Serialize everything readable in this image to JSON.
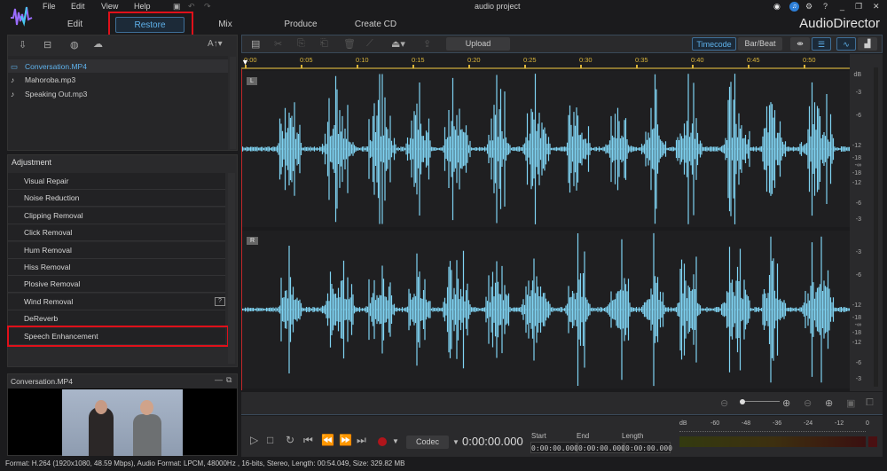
{
  "menu": {
    "items": [
      "File",
      "Edit",
      "View",
      "Help"
    ],
    "title": "audio project",
    "app_name": "AudioDirector"
  },
  "tabs": [
    {
      "label": "Edit"
    },
    {
      "label": "Restore"
    },
    {
      "label": "Mix"
    },
    {
      "label": "Produce"
    },
    {
      "label": "Create CD"
    }
  ],
  "left": {
    "font_btn": "A↑▾",
    "media": [
      {
        "name": "Conversation.MP4",
        "type": "video"
      },
      {
        "name": "Mahoroba.mp3",
        "type": "audio"
      },
      {
        "name": "Speaking Out.mp3",
        "type": "audio"
      }
    ],
    "adjustment_title": "Adjustment",
    "adjustments": [
      "Visual Repair",
      "Noise Reduction",
      "Clipping Removal",
      "Click Removal",
      "Hum Removal",
      "Hiss Removal",
      "Plosive Removal",
      "Wind Removal",
      "DeReverb",
      "Speech Enhancement"
    ],
    "preview_title": "Conversation.MP4"
  },
  "toolbar": {
    "upload": "Upload",
    "timecode": "Timecode",
    "barbeat": "Bar/Beat"
  },
  "ruler": [
    "0:00",
    "0:05",
    "0:10",
    "0:15",
    "0:20",
    "0:25",
    "0:30",
    "0:35",
    "0:40",
    "0:45",
    "0:50"
  ],
  "tracks": [
    {
      "label": "L"
    },
    {
      "label": "R"
    }
  ],
  "db_scale": [
    "-3",
    "-6",
    "-12",
    "-18",
    "-∞",
    "-18",
    "-12",
    "-6",
    "-3"
  ],
  "db_header": "dB",
  "transport": {
    "codec": "Codec",
    "time": "0:00:00.000",
    "start_label": "Start",
    "end_label": "End",
    "length_label": "Length",
    "start": "0:00:00.000",
    "end": "0:00:00.000",
    "length": "0:00:00.000"
  },
  "meter": {
    "labels": [
      "dB",
      "-60",
      "-48",
      "-36",
      "-24",
      "-12",
      "0"
    ]
  },
  "status": "Format: H.264 (1920x1080, 48.59 Mbps), Audio Format: LPCM, 48000Hz , 16-bits, Stereo, Length: 00:54.049, Size: 329.82 MB",
  "colors": {
    "accent": "#5fb2ec",
    "wave": "#7fd3f2",
    "highlight": "#e0101a",
    "ruler": "#d9b43a"
  }
}
